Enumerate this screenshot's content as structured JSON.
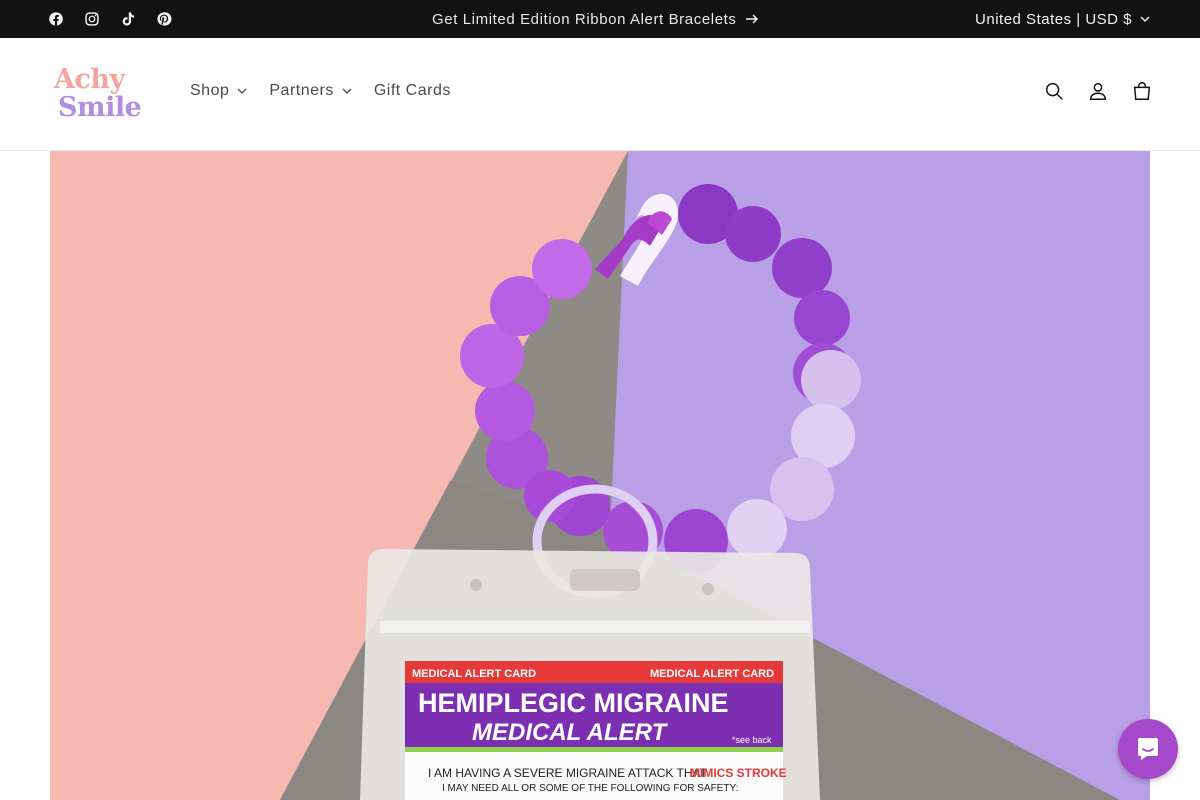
{
  "announcement": {
    "text": "Get Limited Edition Ribbon Alert Bracelets",
    "social_icons": [
      "facebook-icon",
      "instagram-icon",
      "tiktok-icon",
      "pinterest-icon"
    ]
  },
  "locale": {
    "label": "United States | USD $"
  },
  "brand": {
    "logo_line1": "Achy",
    "logo_line2": "Smile",
    "colors": {
      "pink": "#f2a49e",
      "purple": "#b38ee0",
      "accent": "#a548c9"
    }
  },
  "nav": {
    "items": [
      {
        "label": "Shop",
        "dropdown": true
      },
      {
        "label": "Partners",
        "dropdown": true
      },
      {
        "label": "Gift Cards",
        "dropdown": false
      }
    ]
  },
  "header_icons": [
    "search-icon",
    "account-icon",
    "cart-icon"
  ],
  "hero": {
    "card_banner": "MEDICAL ALERT CARD",
    "card_title": "HEMIPLEGIC MIGRAINE",
    "card_subtitle": "MEDICAL ALERT",
    "card_note": "*see back",
    "card_line1_a": "I AM HAVING A SEVERE MIGRAINE ATTACK THAT",
    "card_line1_b": "MIMICS STROKE",
    "card_line2": "I MAY NEED ALL OR SOME OF THE FOLLOWING FOR SAFETY:"
  }
}
